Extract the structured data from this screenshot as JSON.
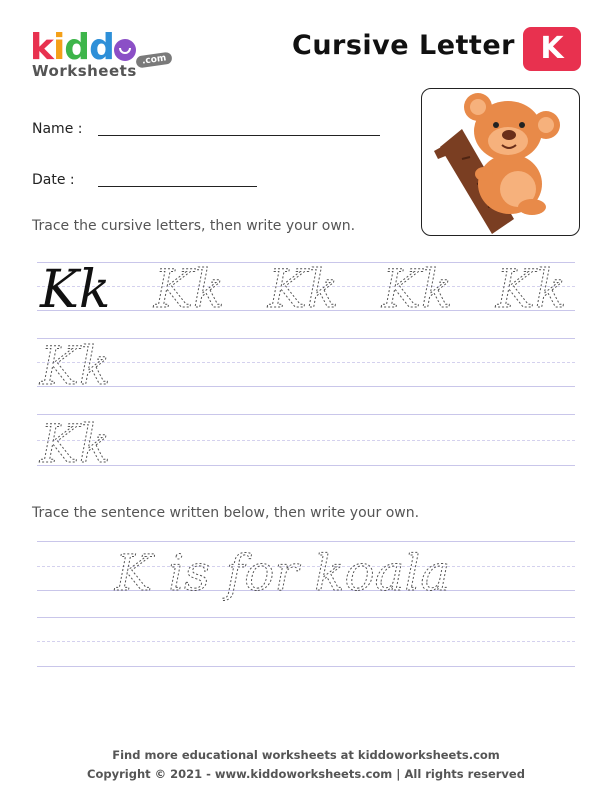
{
  "logo": {
    "letters": [
      {
        "ch": "k",
        "color": "#e8314f"
      },
      {
        "ch": "i",
        "color": "#f4a018"
      },
      {
        "ch": "d",
        "color": "#3db54a"
      },
      {
        "ch": "d",
        "color": "#2d8fd8"
      }
    ],
    "sub": "Worksheets",
    "com": ".com"
  },
  "title": "Cursive Letter",
  "badge_letter": "K",
  "fields": {
    "name_label": "Name :",
    "date_label": "Date :"
  },
  "instruction1": "Trace the cursive letters, then write your own.",
  "letter_pair": "Kk",
  "instruction2": "Trace the sentence written below, then write your own.",
  "sentence": "K is for koala",
  "footer": {
    "line1": "Find more educational worksheets at kiddoworksheets.com",
    "line2": "Copyright © 2021 - www.kiddoworksheets.com  |  All rights reserved"
  },
  "image": {
    "subject": "koala-on-tree"
  }
}
